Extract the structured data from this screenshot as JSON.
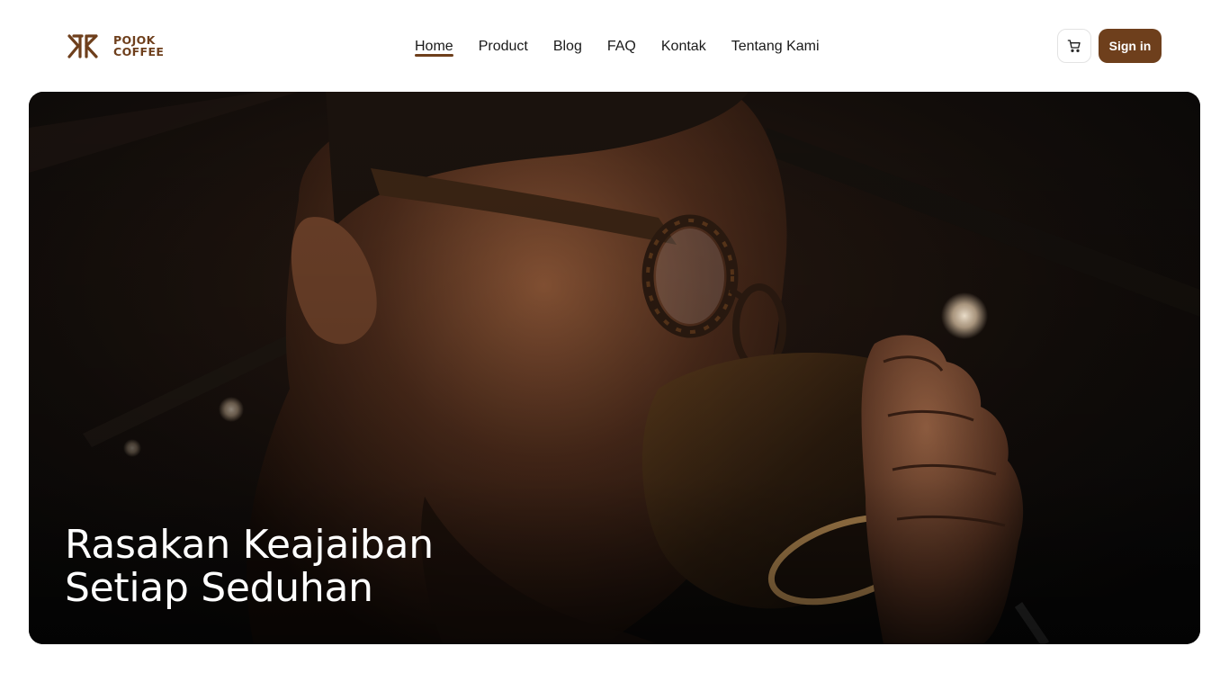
{
  "brand": {
    "name_line1": "POJOK",
    "name_line2": "COFFEE",
    "color": "#6e3f1c"
  },
  "nav": {
    "links": [
      {
        "label": "Home",
        "active": true
      },
      {
        "label": "Product",
        "active": false
      },
      {
        "label": "Blog",
        "active": false
      },
      {
        "label": "FAQ",
        "active": false
      },
      {
        "label": "Kontak",
        "active": false
      },
      {
        "label": "Tentang Kami",
        "active": false
      }
    ]
  },
  "actions": {
    "cart_icon": "cart-icon",
    "signin_label": "Sign in"
  },
  "hero": {
    "title_line1": "Rasakan Keajaiban",
    "title_line2": "Setiap Seduhan",
    "image_subject": "man with glasses sipping coffee"
  }
}
